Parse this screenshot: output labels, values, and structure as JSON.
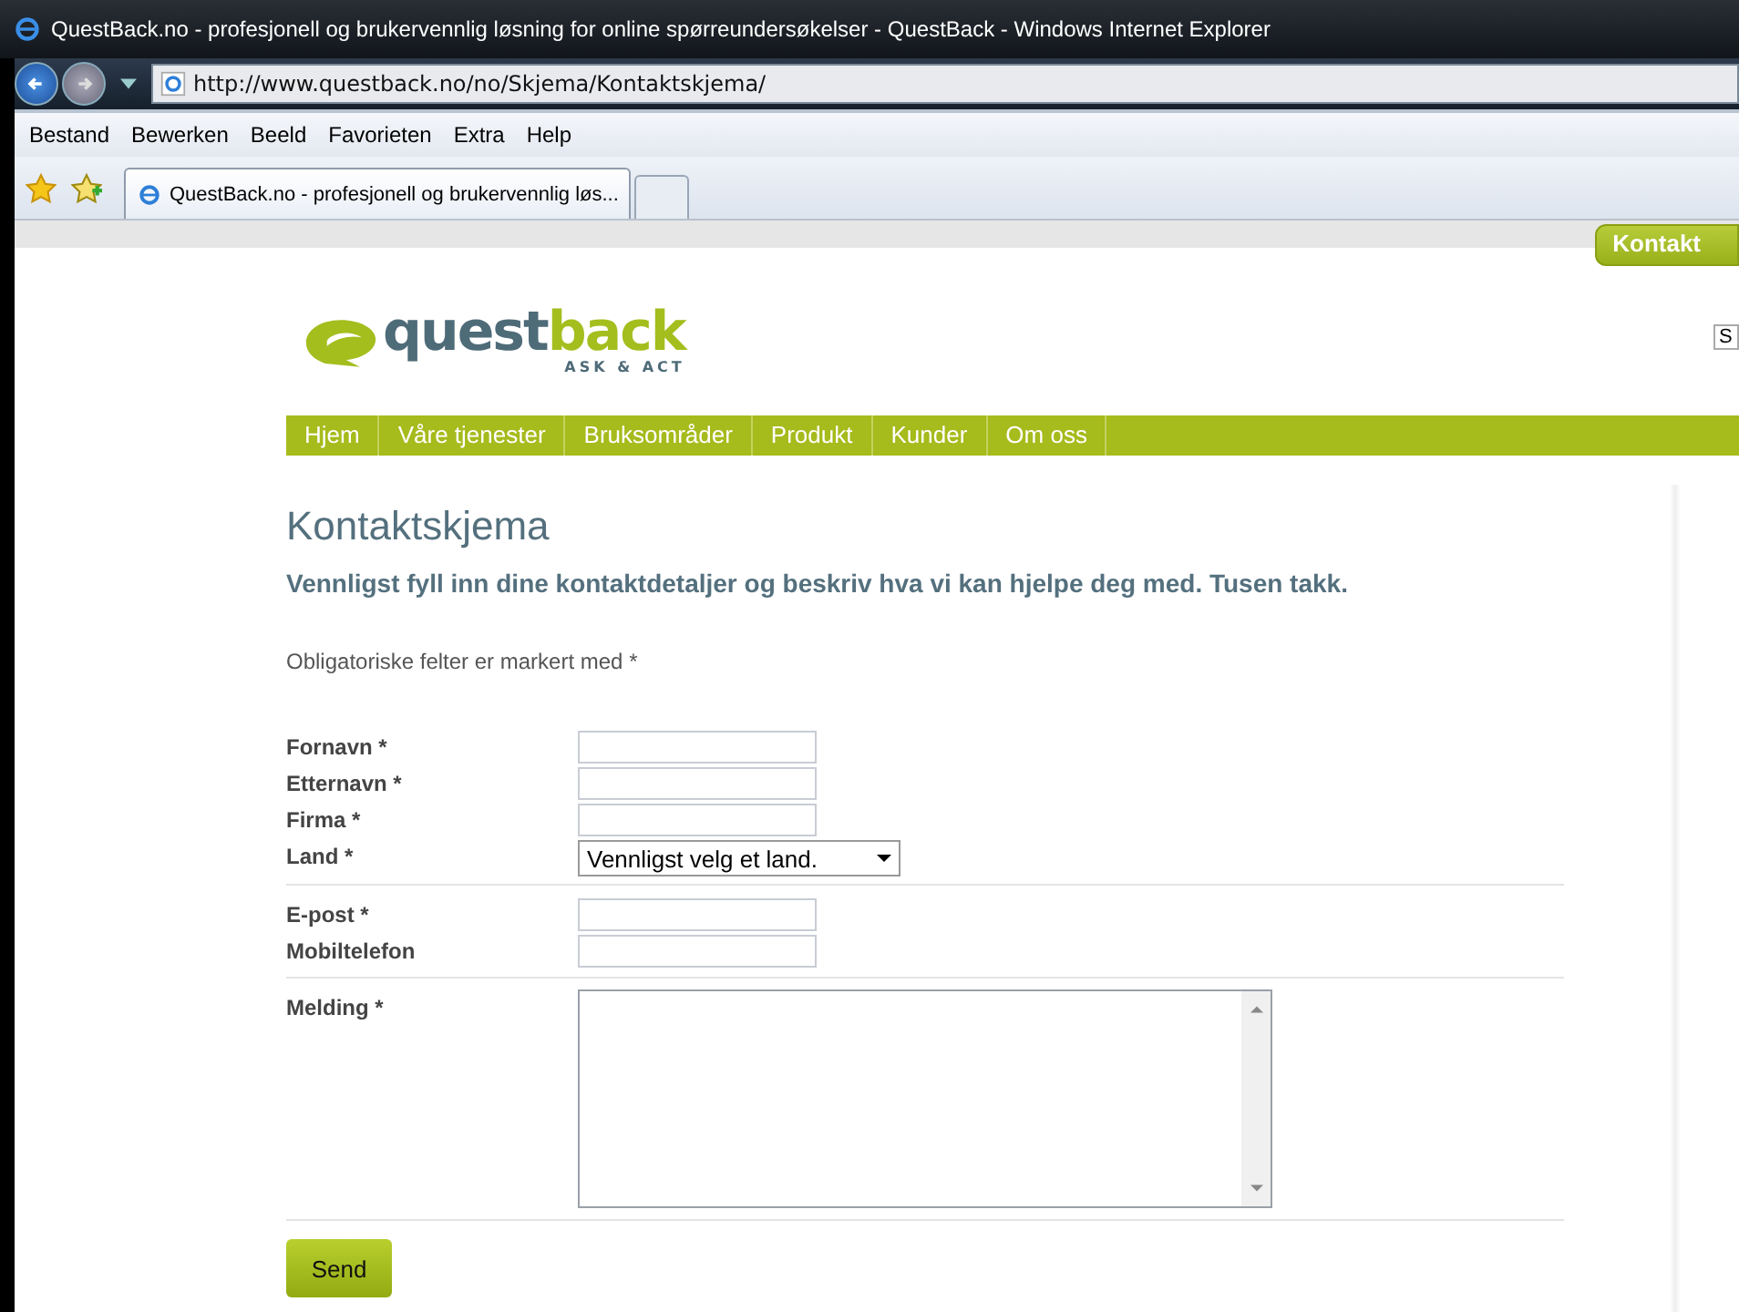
{
  "window": {
    "title": "QuestBack.no - profesjonell og brukervennlig løsning for online spørreundersøkelser - QuestBack - Windows Internet Explorer"
  },
  "address_bar": {
    "url": "http://www.questback.no/no/Skjema/Kontaktskjema/"
  },
  "menu": [
    "Bestand",
    "Bewerken",
    "Beeld",
    "Favorieten",
    "Extra",
    "Help"
  ],
  "tabs": [
    {
      "label": "QuestBack.no - profesjonell og brukervennlig løs...",
      "selected": true
    }
  ],
  "top_link": "Kontakt",
  "logo": {
    "name": "questback",
    "tagline": "ASK & ACT"
  },
  "search": {
    "value": "S"
  },
  "nav": [
    "Hjem",
    "Våre tjenester",
    "Bruksområder",
    "Produkt",
    "Kunder",
    "Om oss"
  ],
  "heading": "Kontaktskjema",
  "intro": "Vennligst fyll inn dine kontaktdetaljer og beskriv hva vi kan hjelpe deg med. Tusen takk.",
  "note": "Obligatoriske felter er markert med *",
  "groups": [
    [
      {
        "label": "Fornavn *",
        "kind": "text"
      },
      {
        "label": "Etternavn *",
        "kind": "text"
      },
      {
        "label": "Firma *",
        "kind": "text"
      },
      {
        "label": "Land *",
        "kind": "select",
        "value": "Vennligst velg et land."
      }
    ],
    [
      {
        "label": "E-post *",
        "kind": "text"
      },
      {
        "label": "Mobiltelefon",
        "kind": "text"
      }
    ],
    [
      {
        "label": "Melding *",
        "kind": "textarea"
      }
    ]
  ],
  "submit": "Send"
}
